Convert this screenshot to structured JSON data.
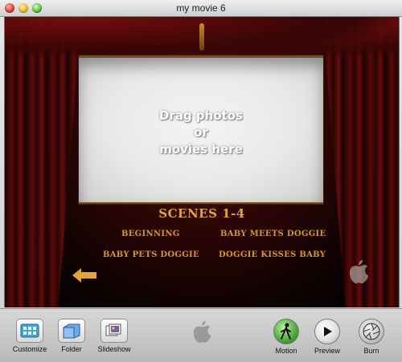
{
  "window": {
    "title": "my movie 6"
  },
  "stage": {
    "drop_text": "Drag photos\nor\nmovies here",
    "menu_title": "SCENES 1-4",
    "scenes": [
      {
        "label": "BEGINNING"
      },
      {
        "label": "BABY MEETS DOGGIE"
      },
      {
        "label": "BABY PETS DOGGIE"
      },
      {
        "label": "DOGGIE KISSES BABY"
      }
    ]
  },
  "toolbar": {
    "customize_label": "Customize",
    "folder_label": "Folder",
    "slideshow_label": "Slideshow",
    "motion_label": "Motion",
    "preview_label": "Preview",
    "burn_label": "Burn"
  },
  "colors": {
    "menu_text": "#e2a43b",
    "scene_text": "#d9962a",
    "curtain": "#5e0a0a"
  },
  "icons": {
    "back": "left-arrow-icon",
    "stage_logo": "apple-logo-icon",
    "toolbar_logo": "apple-logo-icon"
  }
}
